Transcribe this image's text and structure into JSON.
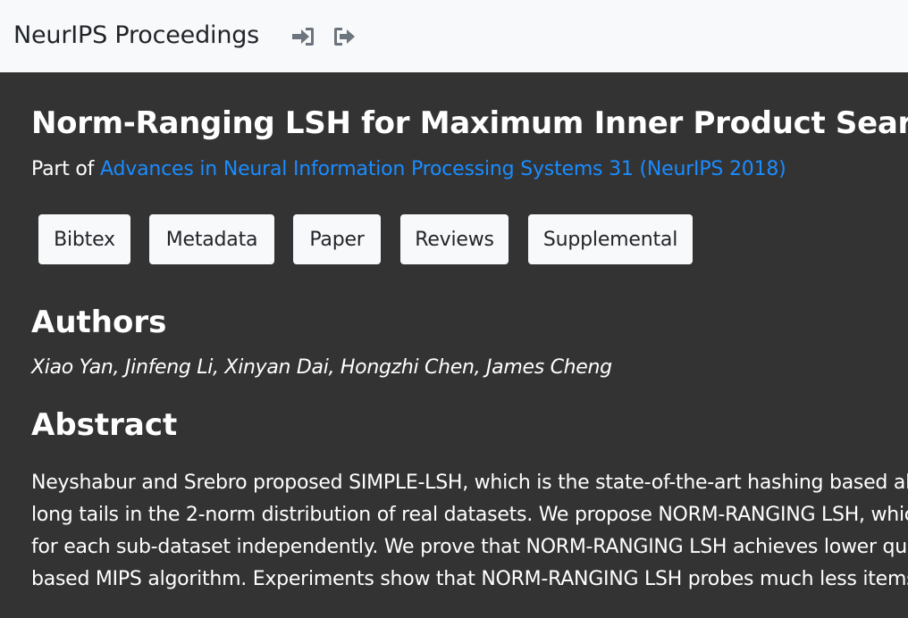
{
  "navbar": {
    "brand": "NeurIPS Proceedings",
    "icons": [
      "login-icon",
      "logout-icon"
    ]
  },
  "paper": {
    "title": "Norm-Ranging LSH for Maximum Inner Product Search",
    "part_of_prefix": "Part of",
    "proceedings_link": "Advances in Neural Information Processing Systems 31 (NeurIPS 2018)"
  },
  "buttons": {
    "bibtex": "Bibtex",
    "metadata": "Metadata",
    "paper": "Paper",
    "reviews": "Reviews",
    "supplemental": "Supplemental"
  },
  "authors": {
    "heading": "Authors",
    "names": "Xiao Yan, Jinfeng Li, Xinyan Dai, Hongzhi Chen, James Cheng"
  },
  "abstract": {
    "heading": "Abstract",
    "lines": [
      "Neyshabur and Srebro proposed SIMPLE-LSH, which is the state-of-the-art hashing based alg",
      "long tails in the 2-norm distribution of real datasets. We propose NORM-RANGING LSH, whic",
      "for each sub-dataset independently. We prove that NORM-RANGING LSH achieves lower que",
      "based MIPS algorithm. Experiments show that NORM-RANGING LSH probes much less items"
    ]
  },
  "colors": {
    "navbar_bg": "#f8f9fa",
    "page_bg": "#333333",
    "link": "#1a8cff",
    "button_bg": "#f8f9fa",
    "text": "#ffffff"
  }
}
